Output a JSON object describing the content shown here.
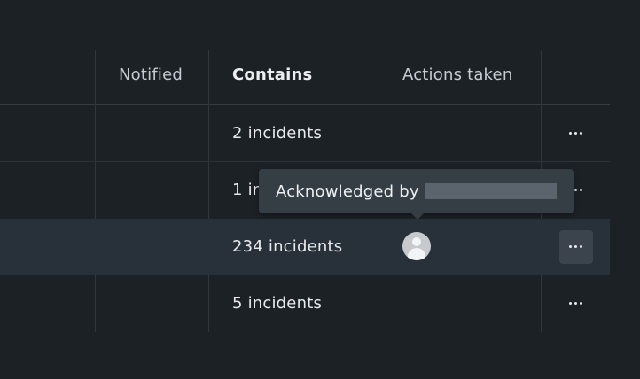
{
  "columns": {
    "notified": "Notified",
    "contains": "Contains",
    "actions_taken": "Actions taken"
  },
  "rows": [
    {
      "contains": "2 incidents",
      "actions": ""
    },
    {
      "contains": "1 in",
      "actions": ""
    },
    {
      "contains": "234 incidents",
      "actions": "avatar"
    },
    {
      "contains": "5 incidents",
      "actions": ""
    }
  ],
  "tooltip": {
    "label": "Acknowledged by"
  },
  "icons": {
    "row_menu": "ellipsis-horizontal-icon",
    "user_avatar": "user-avatar-icon"
  },
  "colors": {
    "background": "#1c2126",
    "row_highlight": "#283139",
    "tooltip_bg": "#353e45"
  }
}
